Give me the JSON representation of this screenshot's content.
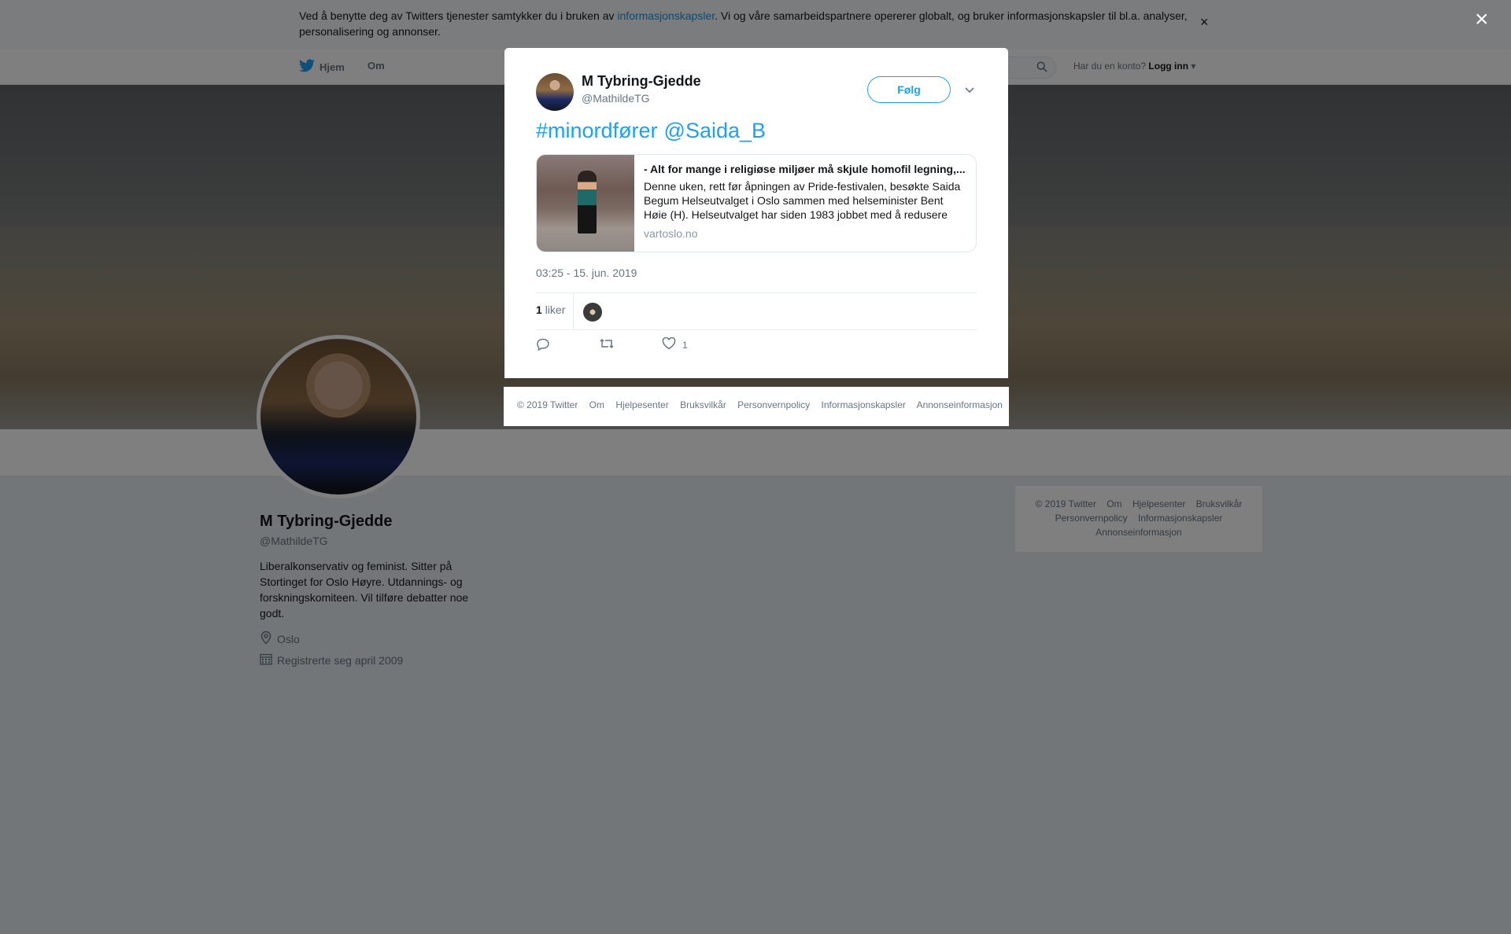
{
  "cookie_bar": {
    "text_before": "Ved å benytte deg av Twitters tjenester samtykker du i bruken av ",
    "link": "informasjonskapsler",
    "text_after": ". Vi og våre samarbeidspartnere opererer globalt, og bruker informasjonskapsler til bl.a. analyser, personalisering og annonser.",
    "close": "×"
  },
  "nav": {
    "home": "Hjem",
    "about": "Om",
    "account_prompt": "Har du en konto?",
    "login": "Logg inn"
  },
  "profile": {
    "name": "M Tybring-Gjedde",
    "handle": "@MathildeTG",
    "bio": "Liberalkonservativ og feminist. Sitter på Stortinget for Oslo Høyre. Utdannings- og forskningskomiteen. Vil tilføre debatter noe godt.",
    "location": "Oslo",
    "joined": "Registrerte seg april 2009"
  },
  "side_footer": {
    "links": [
      "© 2019 Twitter",
      "Om",
      "Hjelpesenter",
      "Bruksvilkår",
      "Personvernpolicy",
      "Informasjonskapsler",
      "Annonseinformasjon"
    ]
  },
  "overlay": {
    "close": "×"
  },
  "tweet": {
    "author_name": "M Tybring-Gjedde",
    "author_handle": "@MathildeTG",
    "follow_label": "Følg",
    "hashtag": "#minordfører",
    "mention": "@Saida_B",
    "card": {
      "title": "- Alt for mange i religiøse miljøer må skjule homofil legning,...",
      "description": "Denne uken, rett før åpningen av Pride-festivalen, besøkte Saida Begum Helseutvalget i Oslo sammen med helseminister Bent Høie (H). Helseutvalget har siden 1983 jobbet med å redusere",
      "domain": "vartoslo.no"
    },
    "timestamp": "03:25 - 15. jun. 2019",
    "likes_count": "1",
    "likes_label": "liker",
    "like_action_count": "1"
  },
  "modal_footer": {
    "links": [
      "© 2019 Twitter",
      "Om",
      "Hjelpesenter",
      "Bruksvilkår",
      "Personvernpolicy",
      "Informasjonskapsler",
      "Annonseinformasjon"
    ]
  },
  "colors": {
    "accent": "#1da1f2",
    "link": "#1b95e0",
    "overlay": "rgba(0,0,0,0.5)"
  }
}
